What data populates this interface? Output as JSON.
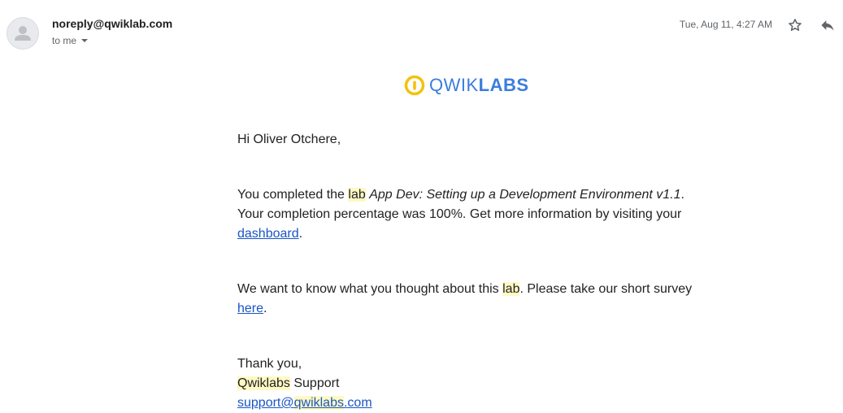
{
  "header": {
    "sender": "noreply@qwiklab.com",
    "recipient": "to me",
    "date": "Tue, Aug 11, 4:27 AM",
    "icons": [
      "avatar-icon",
      "star-icon",
      "reply-icon",
      "chevron-down-icon"
    ]
  },
  "logo": {
    "part1": "QWIK",
    "part2": "LABS",
    "icon": "qwiklabs-logo-icon",
    "colors": {
      "text": "#3b7ddd",
      "ring": "#f4c20d"
    }
  },
  "body": {
    "greeting": "Hi Oliver Otchere,",
    "completed_prefix": "You completed the ",
    "lab_word": "lab",
    "lab_name": "App Dev: Setting up a Development Environment v1.1",
    "completed_suffix": ". Your completion percentage was 100%. Get more information by visiting your ",
    "dashboard_link": "dashboard",
    "period": ".",
    "survey_prefix": "We want to know what you thought about this ",
    "survey_lab_word": "lab",
    "survey_middle": ". Please take our short survey ",
    "here_link": "here",
    "survey_period": ".",
    "thanks": "Thank you,",
    "support_brand": "Qwiklabs",
    "support_suffix": " Support",
    "email_prefix": "support@",
    "email_brand": "qwiklabs",
    "email_suffix": ".com"
  },
  "colors": {
    "link": "#1a55c4",
    "highlight": "#fff9c4"
  }
}
